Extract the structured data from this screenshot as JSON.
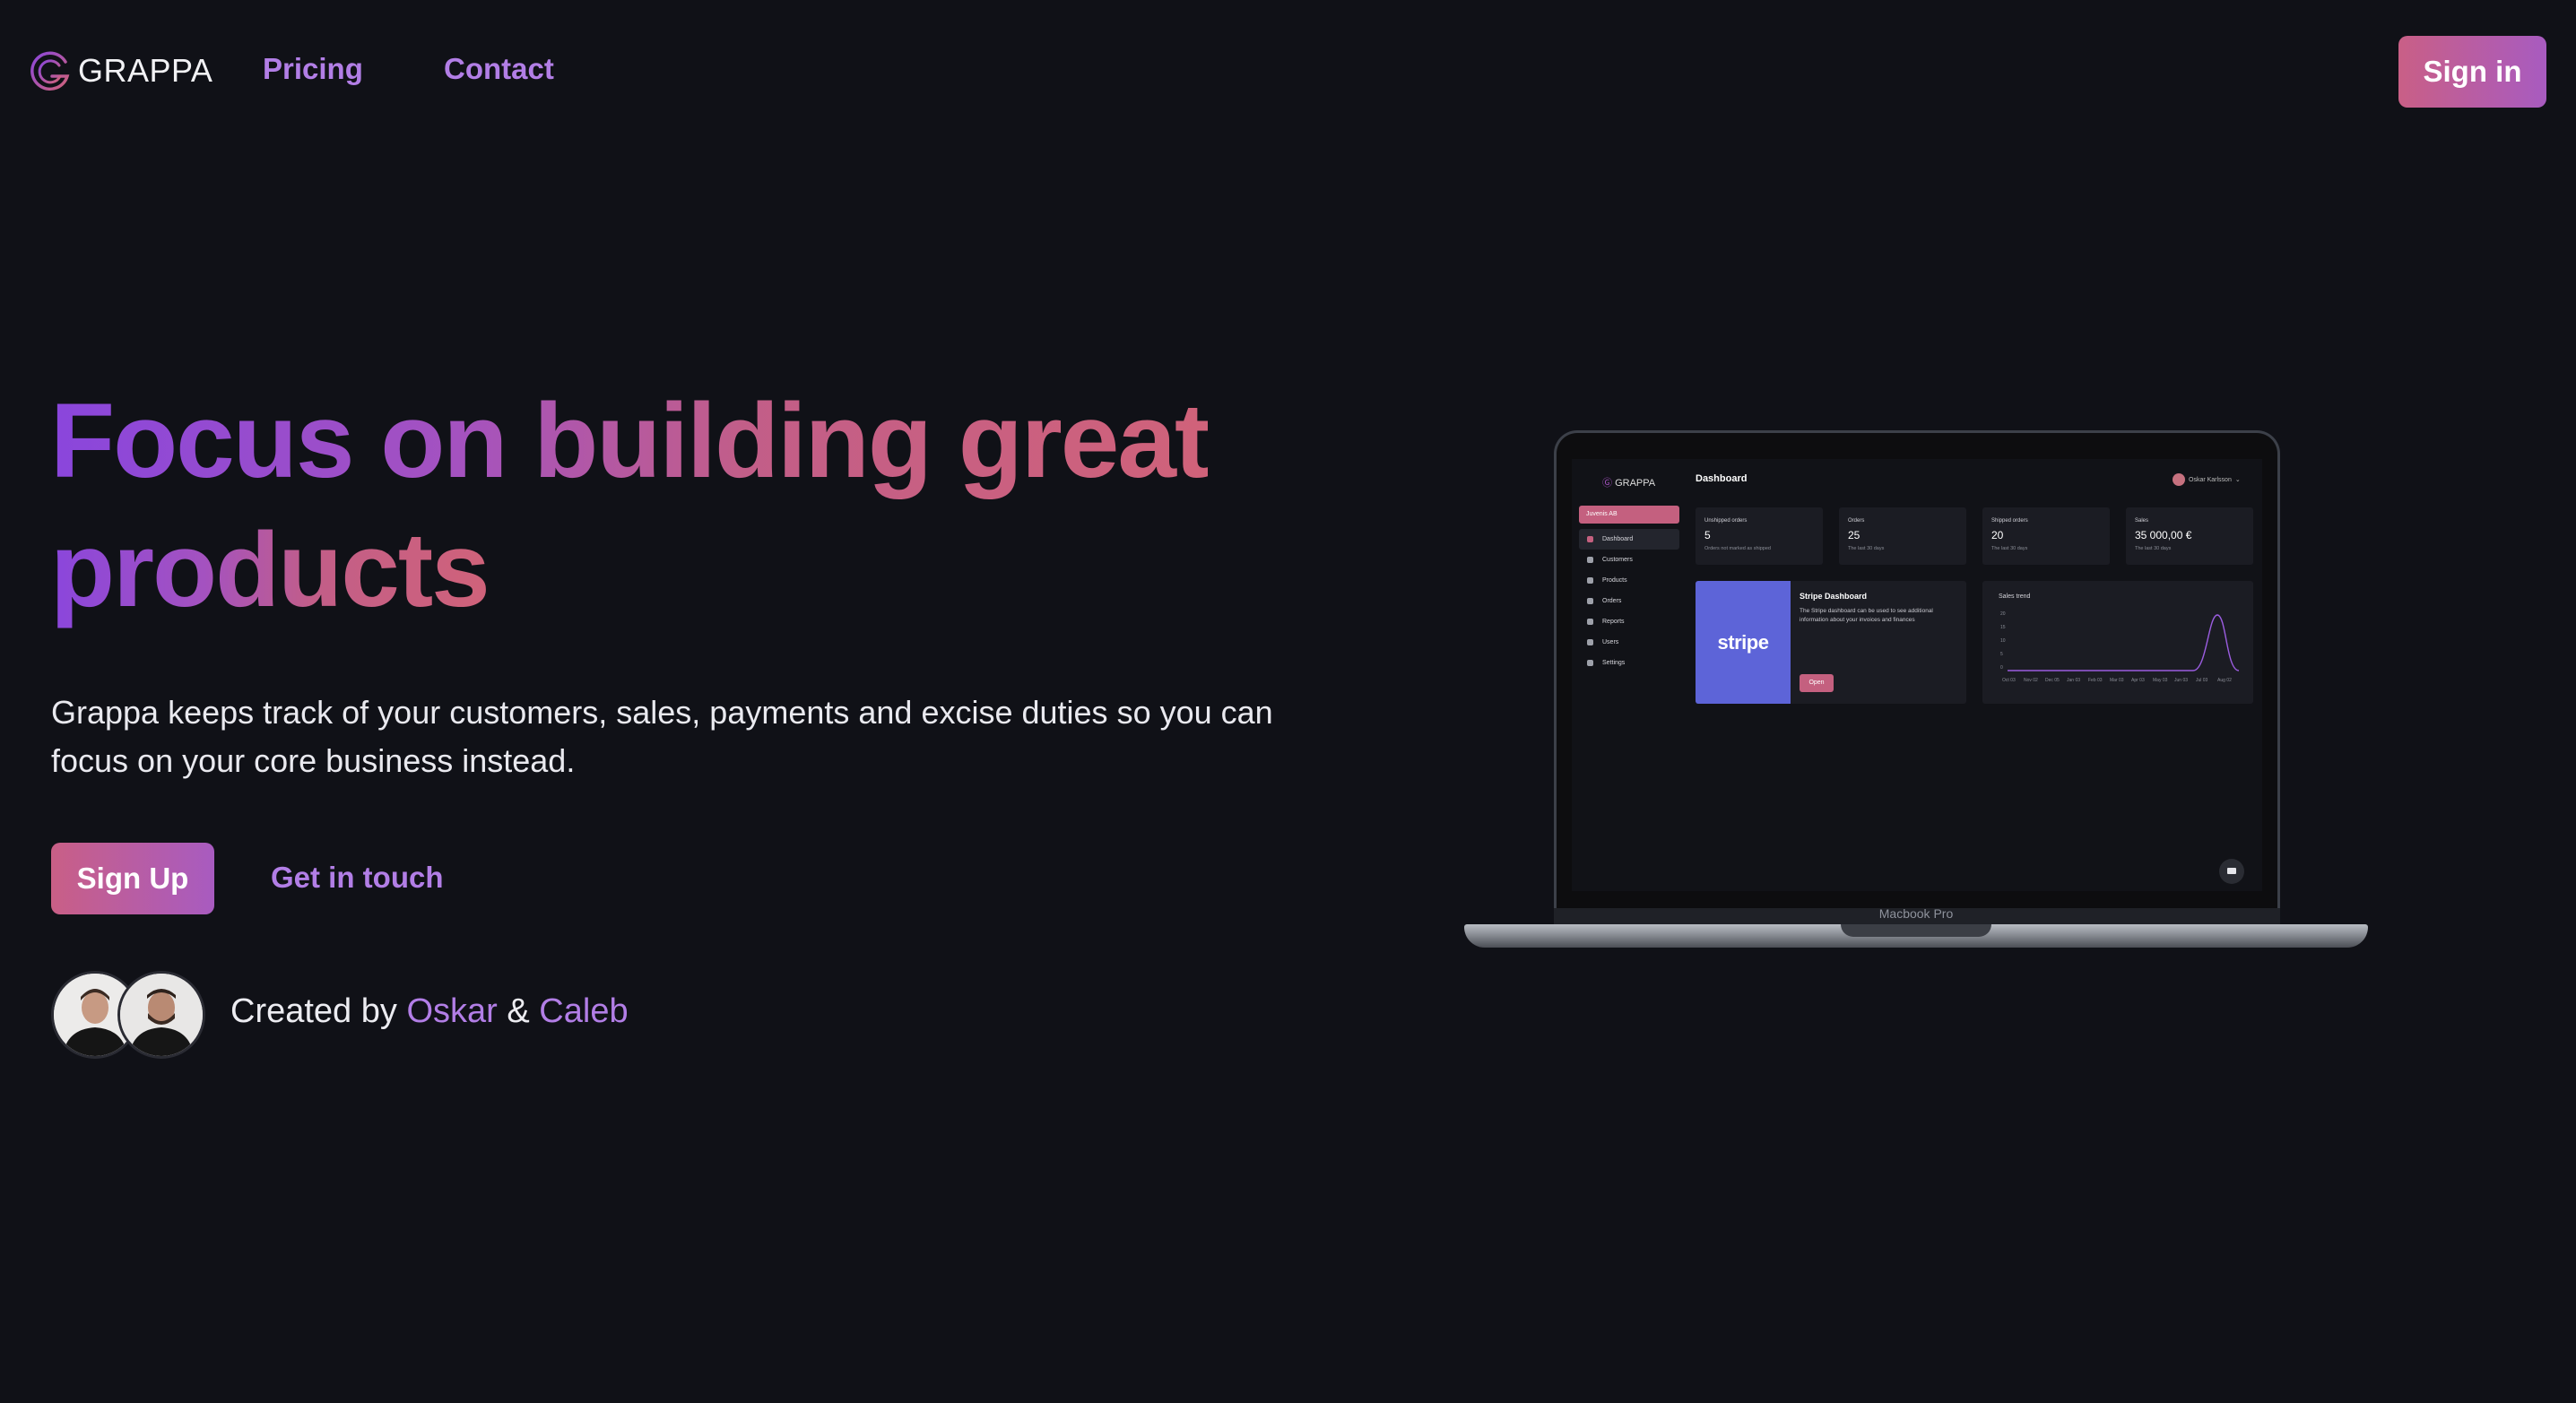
{
  "nav": {
    "brand": "GRAPPA",
    "links": [
      "Pricing",
      "Contact"
    ],
    "signin_label": "Sign in"
  },
  "hero": {
    "headline_line1": "Focus on building great",
    "headline_line2": "products",
    "subtext": "Grappa keeps track of your customers, sales, payments and excise duties so you can focus on your core business instead.",
    "signup_label": "Sign Up",
    "contact_label": "Get in touch",
    "credit_prefix": "Created by",
    "credit_author1": "Oskar",
    "credit_amp": "&",
    "credit_author2": "Caleb"
  },
  "laptop": {
    "model": "Macbook Pro",
    "app": {
      "brand": "GRAPPA",
      "page_title": "Dashboard",
      "user_name": "Oskar Karlsson",
      "org": "Juvenis AB",
      "sidebar": [
        "Dashboard",
        "Customers",
        "Products",
        "Orders",
        "Reports",
        "Users",
        "Settings"
      ],
      "stats": [
        {
          "label": "Unshipped orders",
          "value": "5",
          "sub": "Orders not marked as shipped"
        },
        {
          "label": "Orders",
          "value": "25",
          "sub": "The last 30 days"
        },
        {
          "label": "Shipped orders",
          "value": "20",
          "sub": "The last 30 days"
        },
        {
          "label": "Sales",
          "value": "35 000,00 €",
          "sub": "The last 30 days"
        }
      ],
      "stripe": {
        "logo": "stripe",
        "title": "Stripe Dashboard",
        "desc": "The Stripe dashboard can be used to see additional information about your invoices and finances",
        "button": "Open"
      },
      "trend": {
        "title": "Sales trend",
        "yticks": [
          "20",
          "15",
          "10",
          "5",
          "0"
        ],
        "xticks": [
          "Oct 03",
          "Nov 02",
          "Dec 05",
          "Jan 03",
          "Feb 03",
          "Mar 03",
          "Apr 03",
          "May 03",
          "Jun 03",
          "Jul 03",
          "Aug 02"
        ]
      }
    }
  },
  "colors": {
    "background": "#101117",
    "accent_purple": "#b27ee6",
    "gradient_start": "#8a46dc",
    "gradient_end": "#d0627a",
    "button_gradient_start": "#c95f86",
    "button_gradient_end": "#a85bc0"
  }
}
